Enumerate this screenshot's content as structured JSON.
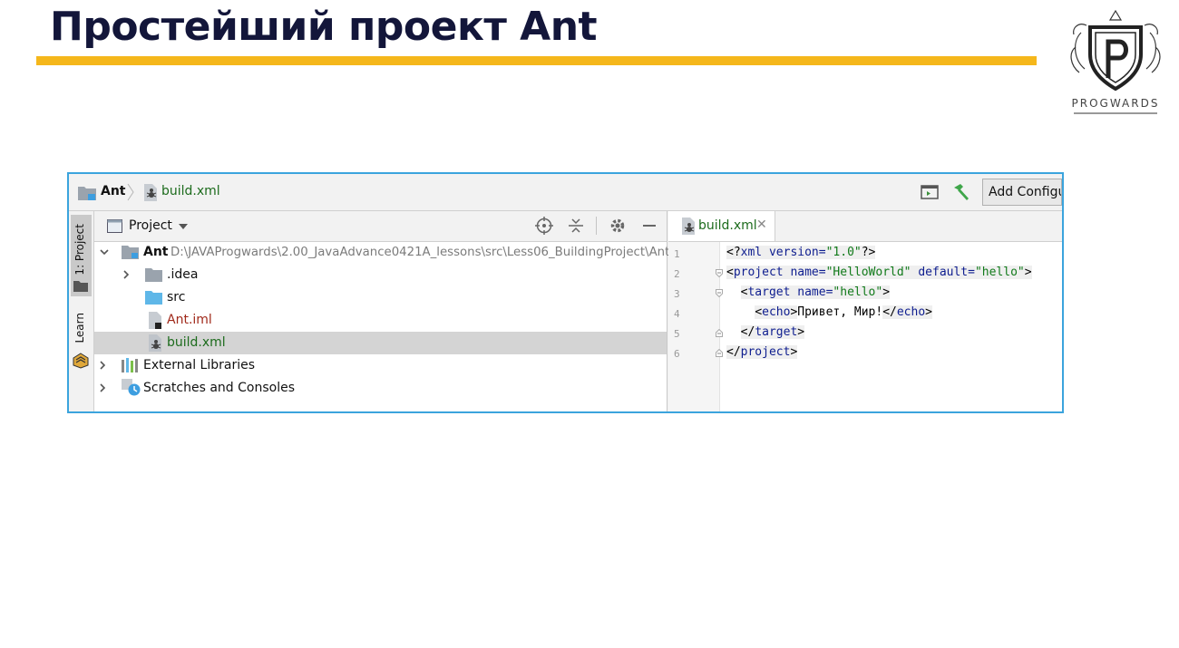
{
  "slide": {
    "title": "Простейший проект Ant"
  },
  "logo": {
    "text": "PROGWARDS"
  },
  "colors": {
    "accent_bar": "#f5b71b",
    "frame": "#3ba4dd",
    "title_text": "#13163a",
    "file_green": "#1c6b1c",
    "iml_red": "#a0291a"
  },
  "ide": {
    "breadcrumb": {
      "project": "Ant",
      "file": "build.xml"
    },
    "toolbar": {
      "add_config_label": "Add Configuration..."
    },
    "side_tabs": [
      {
        "label": "1: Project",
        "icon": "folder-icon"
      },
      {
        "label": "Learn",
        "icon": "learn-icon"
      }
    ],
    "project_panel": {
      "view_label": "Project",
      "tree": [
        {
          "name": "Ant",
          "path": "D:\\JAVAProgwards\\2.00_JavaAdvance0421A_lessons\\src\\Less06_BuildingProject\\Ant",
          "icon": "module-folder-icon"
        },
        {
          "name": ".idea",
          "icon": "folder-icon"
        },
        {
          "name": "src",
          "icon": "source-folder-icon"
        },
        {
          "name": "Ant.iml",
          "icon": "iml-file-icon"
        },
        {
          "name": "build.xml",
          "icon": "ant-build-file-icon"
        },
        {
          "name": "External Libraries",
          "icon": "library-icon"
        },
        {
          "name": "Scratches and Consoles",
          "icon": "scratches-icon"
        }
      ]
    },
    "editor": {
      "tab_label": "build.xml",
      "line_numbers": [
        "1",
        "2",
        "3",
        "4",
        "5",
        "6"
      ],
      "code": {
        "l1_open": "<?",
        "l1_tag": "xml",
        "l1_attr": " version=",
        "l1_val": "\"1.0\"",
        "l1_close": "?>",
        "l2_lt": "<",
        "l2_tag": "project",
        "l2_attr1": " name=",
        "l2_val1": "\"HelloWorld\"",
        "l2_attr2": " default=",
        "l2_val2": "\"hello\"",
        "l2_gt": ">",
        "l3_indent": "  ",
        "l3_lt": "<",
        "l3_tag": "target",
        "l3_attr": " name=",
        "l3_val": "\"hello\"",
        "l3_gt": ">",
        "l4_indent": "    ",
        "l4_lt": "<",
        "l4_tag": "echo",
        "l4_gt": ">",
        "l4_text": "Привет, Мир!",
        "l4_lt2": "</",
        "l4_tag2": "echo",
        "l4_gt2": ">",
        "l5_indent": "  ",
        "l5_lt": "</",
        "l5_tag": "target",
        "l5_gt": ">",
        "l6_lt": "</",
        "l6_tag": "project",
        "l6_gt": ">"
      }
    }
  }
}
